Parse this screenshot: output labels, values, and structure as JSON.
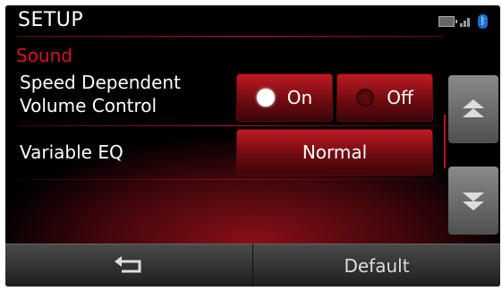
{
  "header": {
    "title": "SETUP",
    "icons": [
      "battery-icon",
      "signal-icon",
      "bluetooth-icon"
    ]
  },
  "section": {
    "title": "Sound"
  },
  "settings": [
    {
      "label_line1": "Speed Dependent",
      "label_line2": "Volume Control",
      "options": [
        "On",
        "Off"
      ],
      "selected": "On"
    },
    {
      "label": "Variable EQ",
      "value": "Normal"
    }
  ],
  "scroll": {
    "up_icon": "chevron-up-icon",
    "down_icon": "chevron-down-icon"
  },
  "bottom_bar": {
    "back_icon": "return-arrow-icon",
    "default_label": "Default"
  },
  "colors": {
    "accent": "#e01020",
    "button_red": "#c01a22",
    "background": "#000000"
  }
}
